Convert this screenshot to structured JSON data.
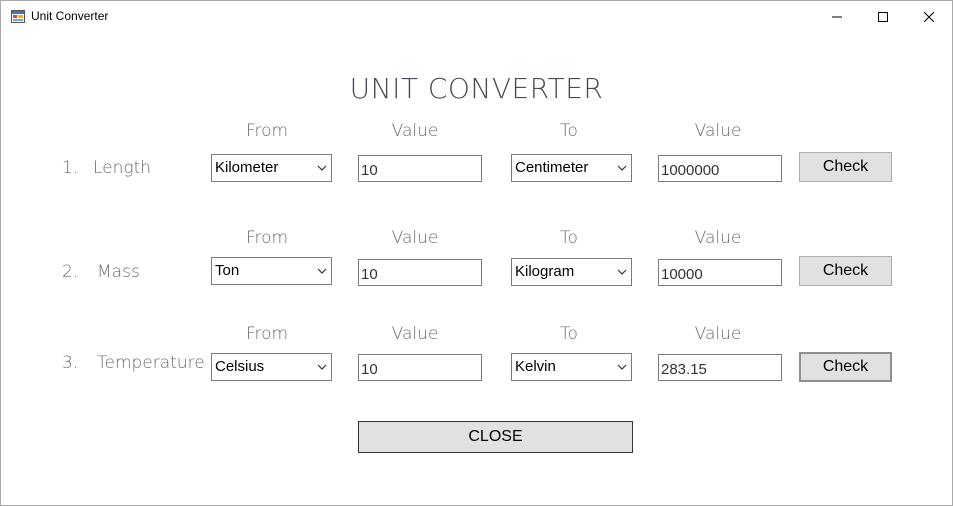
{
  "window": {
    "title": "Unit Converter"
  },
  "heading": "UNIT CONVERTER",
  "headers": {
    "from": "From",
    "value_in": "Value",
    "to": "To",
    "value_out": "Value"
  },
  "rows": [
    {
      "number": "1.",
      "name": "Length",
      "from_unit": "Kilometer",
      "value_in": "10",
      "to_unit": "Centimeter",
      "value_out": "1000000",
      "button": "Check"
    },
    {
      "number": "2.",
      "name": "Mass",
      "from_unit": "Ton",
      "value_in": "10",
      "to_unit": "Kilogram",
      "value_out": "10000",
      "button": "Check"
    },
    {
      "number": "3.",
      "name": "Temperature",
      "from_unit": "Celsius",
      "value_in": "10",
      "to_unit": "Kelvin",
      "value_out": "283.15",
      "button": "Check"
    }
  ],
  "close_button": "CLOSE",
  "icons": {
    "app": "app-icon",
    "minimize": "minimize-icon",
    "maximize": "maximize-icon",
    "close": "close-icon",
    "dropdown": "chevron-down-icon"
  }
}
